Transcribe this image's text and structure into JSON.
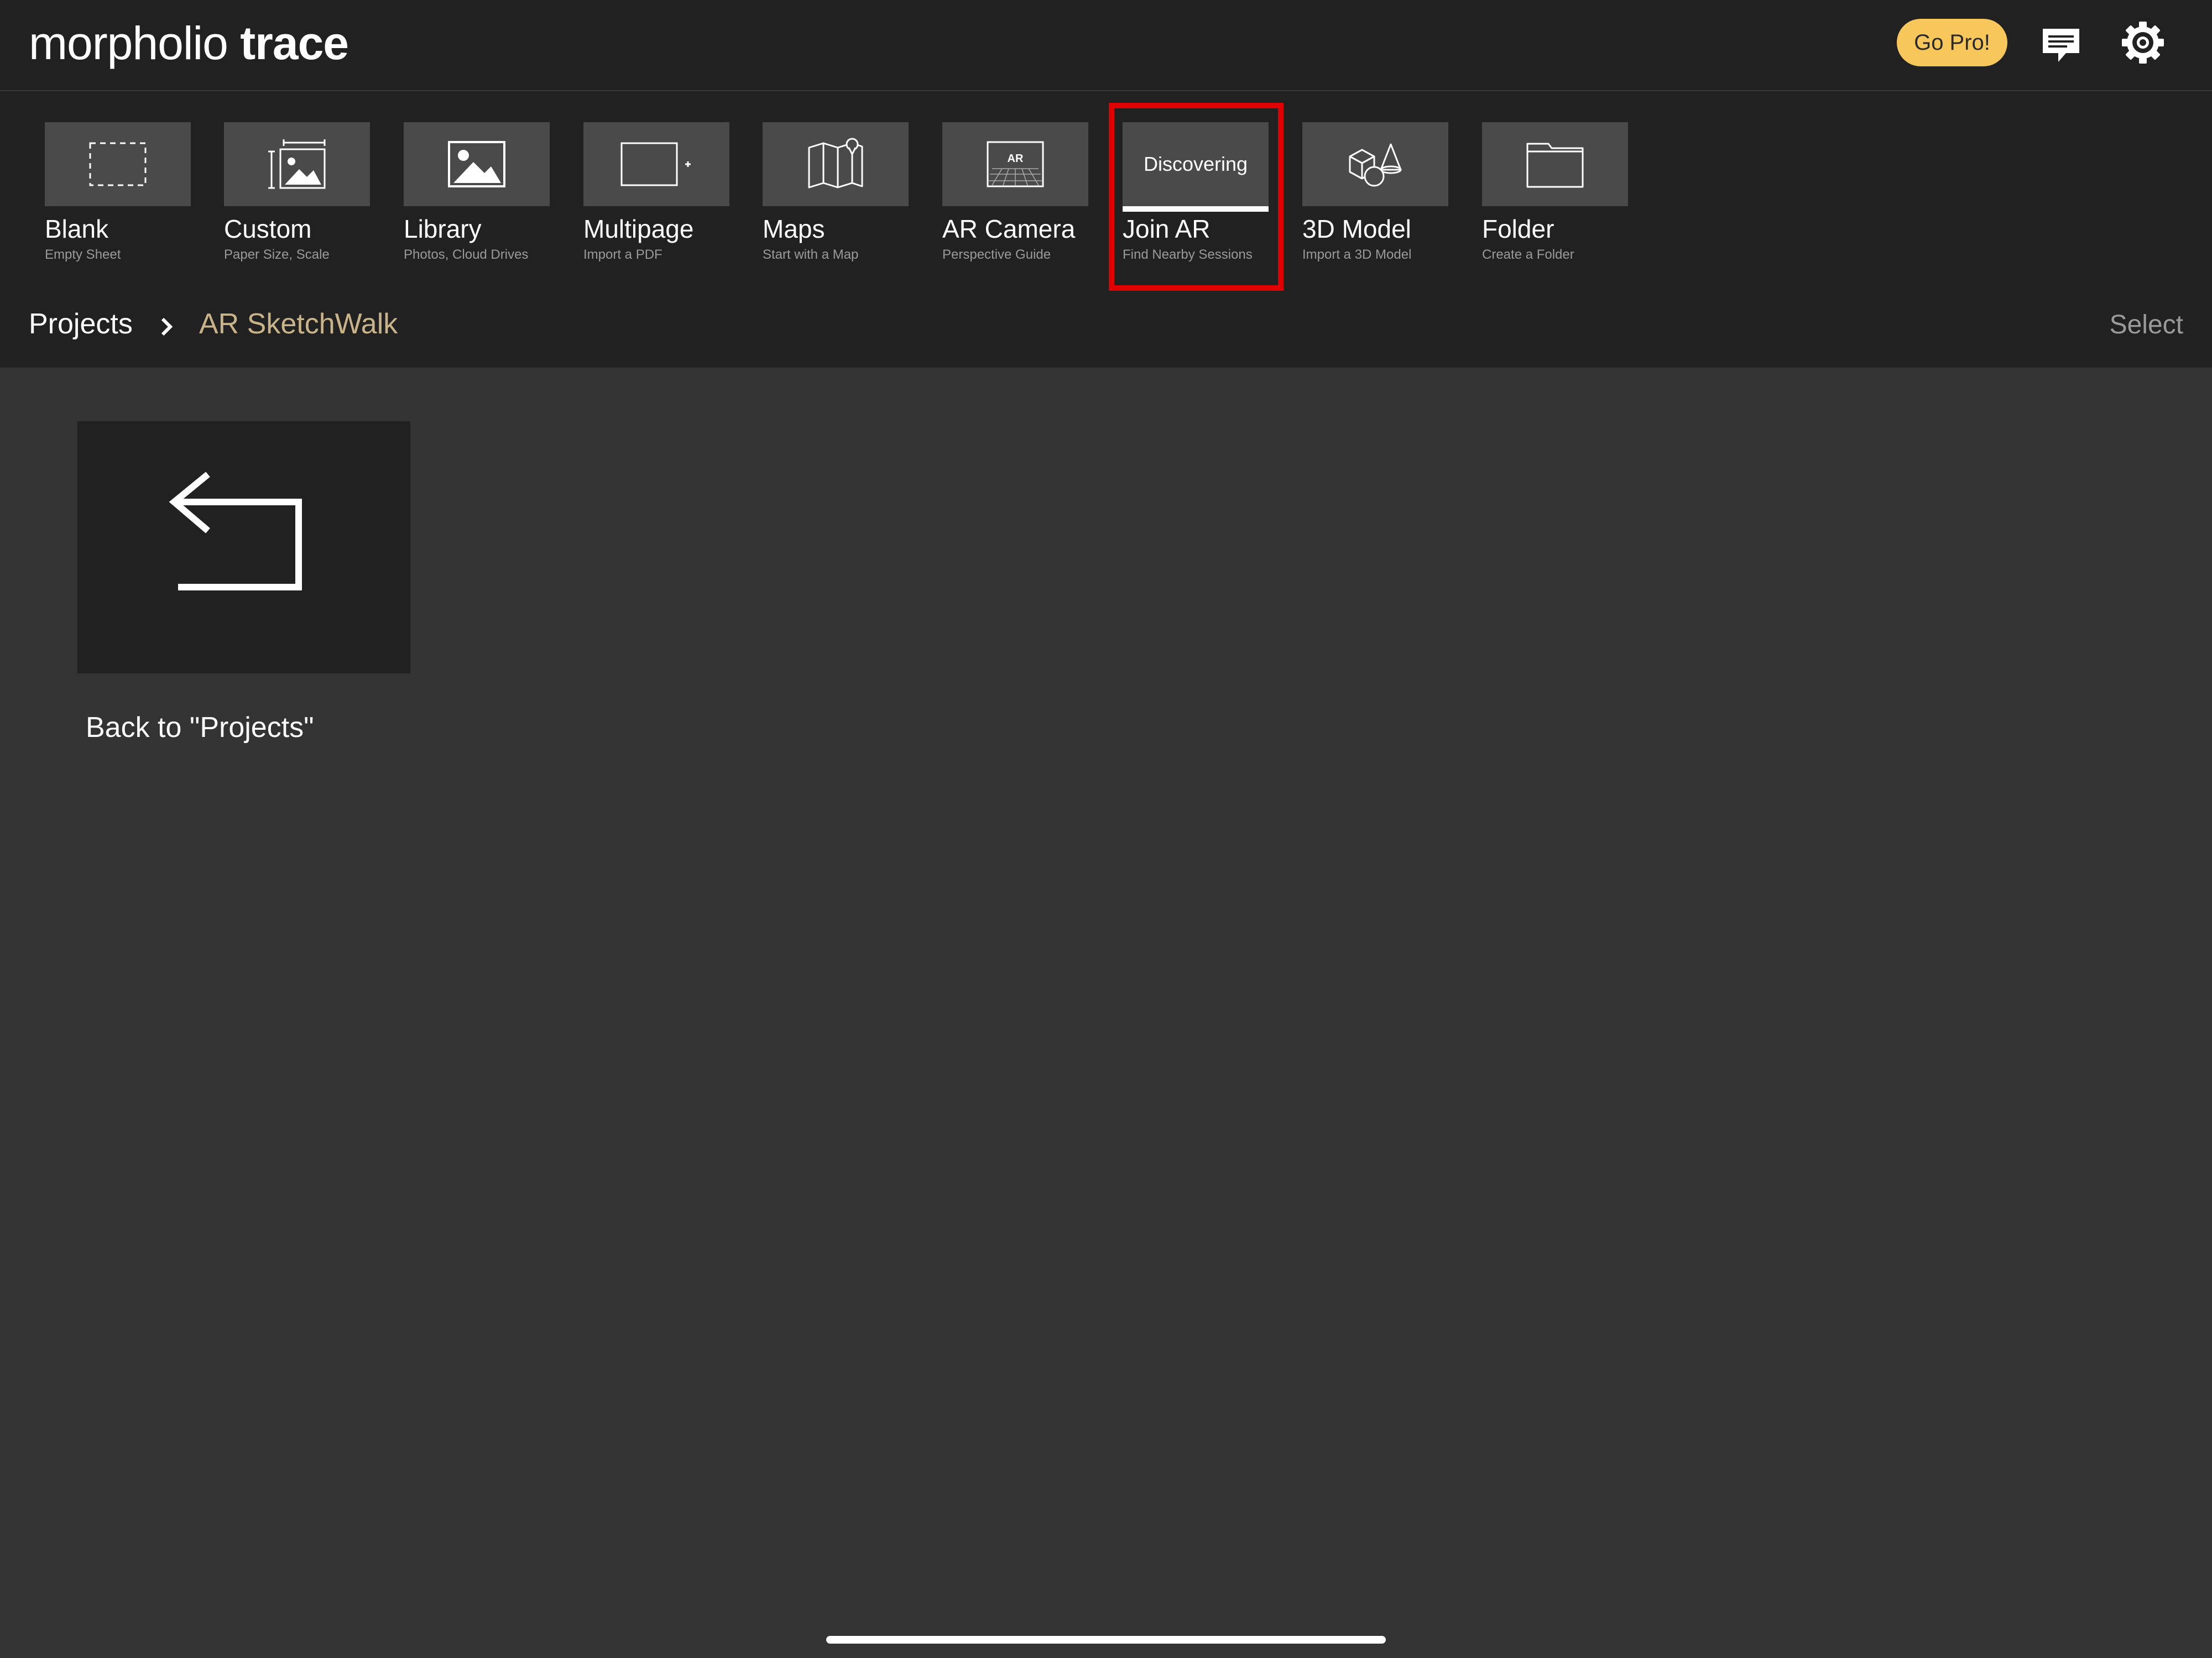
{
  "header": {
    "brand_part1": "morpholio",
    "brand_part2": "trace",
    "go_pro_label": "Go Pro!"
  },
  "toolbar": {
    "items": [
      {
        "title": "Blank",
        "subtitle": "Empty Sheet",
        "icon": "blank-sheet-icon"
      },
      {
        "title": "Custom",
        "subtitle": "Paper Size, Scale",
        "icon": "custom-size-icon"
      },
      {
        "title": "Library",
        "subtitle": "Photos, Cloud Drives",
        "icon": "image-icon"
      },
      {
        "title": "Multipage",
        "subtitle": "Import a PDF",
        "icon": "multipage-icon"
      },
      {
        "title": "Maps",
        "subtitle": "Start with a Map",
        "icon": "map-icon"
      },
      {
        "title": "AR Camera",
        "subtitle": "Perspective Guide",
        "icon": "ar-camera-icon",
        "badge": "AR"
      },
      {
        "title": "Join AR",
        "subtitle": "Find Nearby Sessions",
        "status": "Discovering",
        "highlighted": true
      },
      {
        "title": "3D Model",
        "subtitle": "Import a 3D Model",
        "icon": "3d-model-icon"
      },
      {
        "title": "Folder",
        "subtitle": "Create a Folder",
        "icon": "folder-icon"
      }
    ]
  },
  "breadcrumb": {
    "root": "Projects",
    "current": "AR SketchWalk",
    "select_label": "Select"
  },
  "content": {
    "back_label": "Back to \"Projects\""
  },
  "colors": {
    "header_bg": "#212121",
    "canvas_bg": "#333333",
    "accent": "#f7c75c",
    "breadcrumb_current": "#c9b48a",
    "highlight_border": "#e00000"
  }
}
